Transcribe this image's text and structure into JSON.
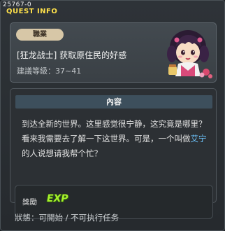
{
  "window": {
    "quest_id": "25767-0",
    "title": "QUEST INFO"
  },
  "header": {
    "job_badge": "職業",
    "quest_name": "[狂龙战士] 获取原住民的好感",
    "level": "建議等級：37~41"
  },
  "content": {
    "heading": "內容",
    "desc_part1": "到达全新的世界。这里感觉很宁静，这究竟是哪里？看来我需要去了解一下这世界。可是，一个叫做",
    "npc_name": "艾宁",
    "desc_part2": "的人说想请我帮个忙？"
  },
  "reward": {
    "label": "獎勵",
    "item": "EXP"
  },
  "status": {
    "text": "狀態：可開始 / 不可执行任务"
  },
  "colors": {
    "title": "#ffe14a",
    "npc_name": "#6ec6ff",
    "exp": "#a6f12c"
  }
}
